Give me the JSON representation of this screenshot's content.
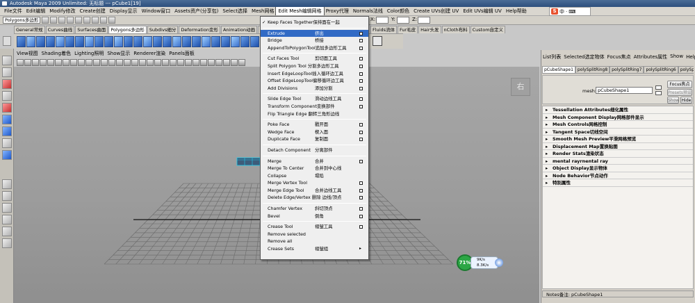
{
  "window": {
    "title": "Autodesk Maya 2009 Unlimited: 无标题   ---   pCube1[19]"
  },
  "menubar": [
    "File文件",
    "Edit编辑",
    "Modify修改",
    "Create创建",
    "Display显示",
    "Window窗口",
    "Assets资产(分享包)",
    "Select选择",
    "Mesh网格",
    "Edit Mesh编辑网格",
    "Proxy代理",
    "Normals法线",
    "Color颜色",
    "Create UVs创建 UV",
    "Edit UVs编辑 UV",
    "Help帮助"
  ],
  "menubar_active_index": 9,
  "ime": {
    "logo": "S",
    "lang": "中"
  },
  "statusline": {
    "mode": "Polygons多边形",
    "x_label": "X:",
    "y_label": "Y:",
    "z_label": "Z:"
  },
  "shelf_tabs": [
    "General常规",
    "Curves曲线",
    "Surfaces曲面",
    "Polygons多边形",
    "Subdivs细分",
    "Deformation变形",
    "Animation动画",
    "Dynamics动力学",
    "Render"
  ],
  "shelf_tabs_active_index": 3,
  "shelf_tabs_right": [
    "Fluids流体",
    "Fur毛皮",
    "Hair头发",
    "nCloth布料",
    "Custom自定义"
  ],
  "panel_menu": [
    "View视图",
    "Shading着色",
    "Lighting照明",
    "Show显示",
    "Renderer渲染",
    "Panels面板"
  ],
  "viewcube_label": "右",
  "hud": {
    "percent": "71%",
    "line1": "9K/s",
    "line2": "8.3K/s"
  },
  "context_menu": [
    {
      "type": "item",
      "label": "Keep Faces Together保持面在一起",
      "zh": "",
      "check": "✓"
    },
    {
      "type": "sep"
    },
    {
      "type": "item",
      "label": "Extrude",
      "zh": "挤出",
      "option": true,
      "highlight": true
    },
    {
      "type": "item",
      "label": "Bridge",
      "zh": "桥接",
      "option": true
    },
    {
      "type": "item",
      "label": "AppendToPolygonTool追加多边形工具",
      "zh": "",
      "option": true
    },
    {
      "type": "sep"
    },
    {
      "type": "item",
      "label": "Cut Faces Tool",
      "zh": "剪切面工具",
      "option": true
    },
    {
      "type": "item",
      "label": "Split Polygon Tool 分割多边形工具",
      "zh": "",
      "option": true
    },
    {
      "type": "item",
      "label": "Insert EdgeLoopTool插入循环边工具",
      "zh": "",
      "option": true
    },
    {
      "type": "item",
      "label": "Offset EdgeLoopTool偏移循环边工具",
      "zh": "",
      "option": true
    },
    {
      "type": "item",
      "label": "Add Divisions",
      "zh": "添加分割",
      "option": true
    },
    {
      "type": "sep"
    },
    {
      "type": "item",
      "label": "Slide Edge Tool",
      "zh": "滑动边线工具",
      "option": true
    },
    {
      "type": "item",
      "label": "Transform Component变换部件",
      "zh": "",
      "option": true
    },
    {
      "type": "item",
      "label": "Flip Triangle Edge 翻转三角形边线",
      "zh": ""
    },
    {
      "type": "sep"
    },
    {
      "type": "item",
      "label": "Poke Face",
      "zh": "戳开面",
      "option": true
    },
    {
      "type": "item",
      "label": "Wedge Face",
      "zh": "楔入面",
      "option": true
    },
    {
      "type": "item",
      "label": "Duplicate Face",
      "zh": "复制面",
      "option": true
    },
    {
      "type": "sep"
    },
    {
      "type": "item",
      "label": "Detach Component",
      "zh": "分离部件"
    },
    {
      "type": "sep"
    },
    {
      "type": "item",
      "label": "Merge",
      "zh": "合并",
      "option": true
    },
    {
      "type": "item",
      "label": "Merge To Center",
      "zh": "合并到中心线"
    },
    {
      "type": "item",
      "label": "Collapse",
      "zh": "塌陷"
    },
    {
      "type": "item",
      "label": "Merge Vertex Tool",
      "zh": "",
      "option": true
    },
    {
      "type": "item",
      "label": "Merge Edge Tool",
      "zh": "合并边线工具",
      "option": true
    },
    {
      "type": "item",
      "label": "Delete Edge/Vertex 删除 边线/顶点",
      "zh": "",
      "option": true
    },
    {
      "type": "sep"
    },
    {
      "type": "item",
      "label": "Chamfer Vertex",
      "zh": "斜切顶点",
      "option": true
    },
    {
      "type": "item",
      "label": "Bevel",
      "zh": "倒角",
      "option": true
    },
    {
      "type": "sep"
    },
    {
      "type": "item",
      "label": "Crease Tool",
      "zh": "褶皱工具",
      "option": true
    },
    {
      "type": "item",
      "label": "Remove selected",
      "zh": ""
    },
    {
      "type": "item",
      "label": "Remove all",
      "zh": ""
    },
    {
      "type": "item",
      "label": "Crease Sets",
      "zh": "褶皱组",
      "submenu": true
    }
  ],
  "right_panel": {
    "menu": [
      "List列表",
      "Selected选定物体",
      "Focus焦点",
      "Attributes属性",
      "Show",
      "Help帮助"
    ],
    "tabs": [
      "pCubeShape1",
      "polySplitRing8",
      "polySplitRing7",
      "polySplitRing6",
      "polySplitRing"
    ],
    "mesh_label": "mesh:",
    "mesh_value": "pCubeShape1",
    "focus_button": "Focus焦点",
    "presets_button": "Presets预设",
    "show_button": "Show",
    "hide_button": "Hide",
    "sections": [
      "Tessellation Attributes细化属性",
      "Mesh Component Display网格部件显示",
      "Mesh Controls网格控制",
      "Tangent Space切线空间",
      "Smooth Mesh Preview平滑网格预览",
      "Displacement Map置换贴图",
      "Render Stats渲染状态",
      "mental rayrnental ray",
      "Object Display显示物体",
      "Node Behavior节点动作",
      "特别属性"
    ],
    "notes": "Notes备注: pCubeShape1"
  }
}
